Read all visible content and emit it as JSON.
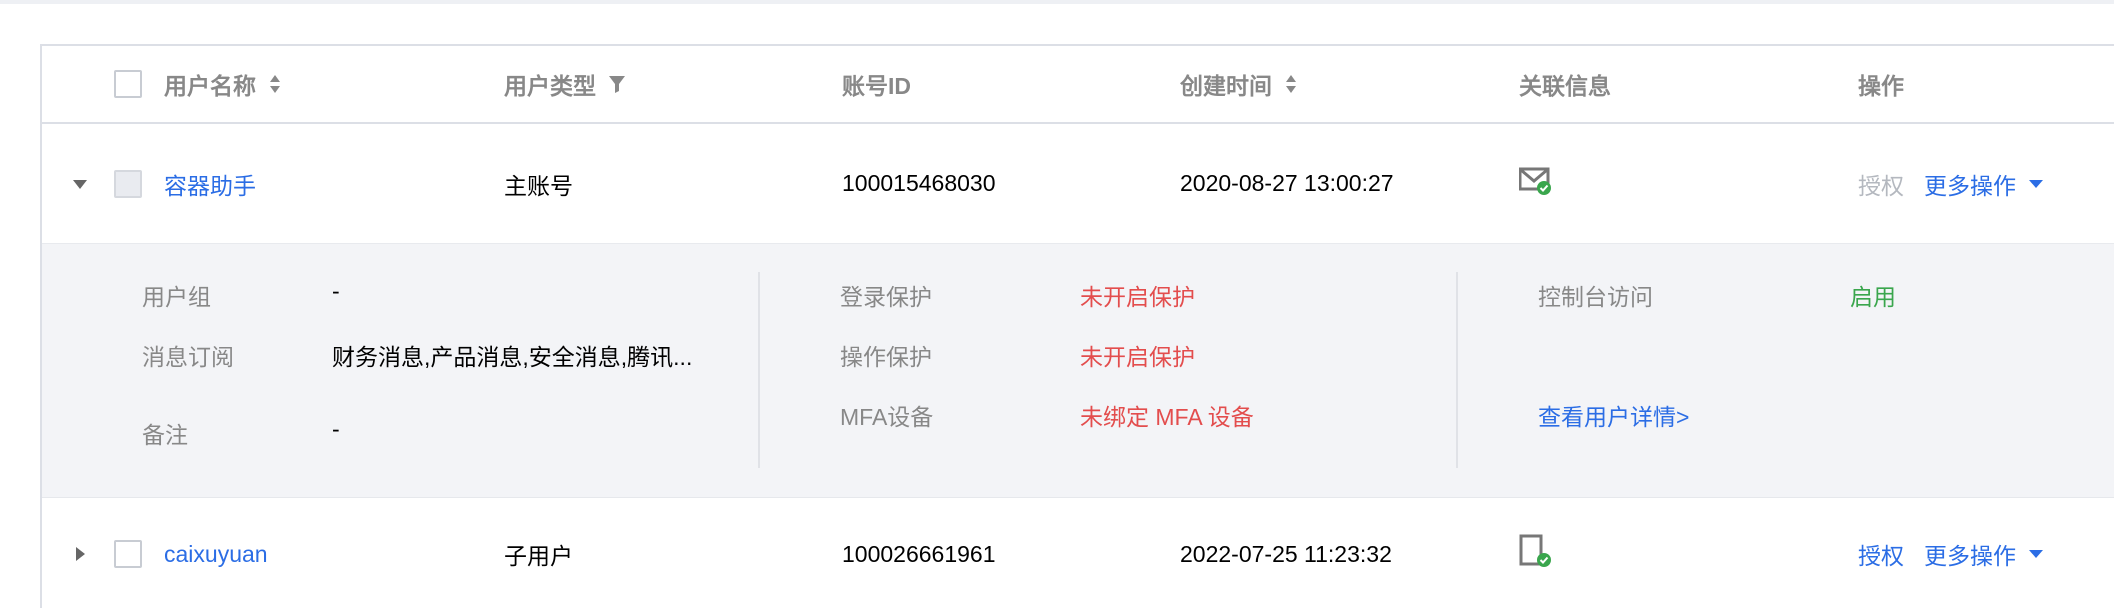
{
  "table": {
    "columns": {
      "username": "用户名称",
      "user_type": "用户类型",
      "account_id": "账号ID",
      "created_at": "创建时间",
      "linked_info": "关联信息",
      "actions": "操作"
    },
    "rows": [
      {
        "name": "容器助手",
        "type": "主账号",
        "account_id": "100015468030",
        "created_at": "2020-08-27 13:00:27",
        "linked_icon": "email-verified-icon",
        "authorize": "授权",
        "more_actions": "更多操作",
        "expanded": true
      },
      {
        "name": "caixuyuan",
        "type": "子用户",
        "account_id": "100026661961",
        "created_at": "2022-07-25 11:23:32",
        "linked_icon": "phone-verified-icon",
        "authorize": "授权",
        "more_actions": "更多操作",
        "expanded": false
      }
    ],
    "detail": {
      "user_group_label": "用户组",
      "user_group_value": "-",
      "subscription_label": "消息订阅",
      "subscription_value": "财务消息,产品消息,安全消息,腾讯...",
      "remark_label": "备注",
      "remark_value": "-",
      "login_protect_label": "登录保护",
      "login_protect_value": "未开启保护",
      "op_protect_label": "操作保护",
      "op_protect_value": "未开启保护",
      "mfa_label": "MFA设备",
      "mfa_value": "未绑定 MFA 设备",
      "console_access_label": "控制台访问",
      "console_access_value": "启用",
      "view_details_link": "查看用户详情>"
    }
  },
  "colors": {
    "link": "#2b6de5",
    "danger": "#e34d4d",
    "success": "#3aa64d",
    "muted": "#b4b8bf"
  }
}
